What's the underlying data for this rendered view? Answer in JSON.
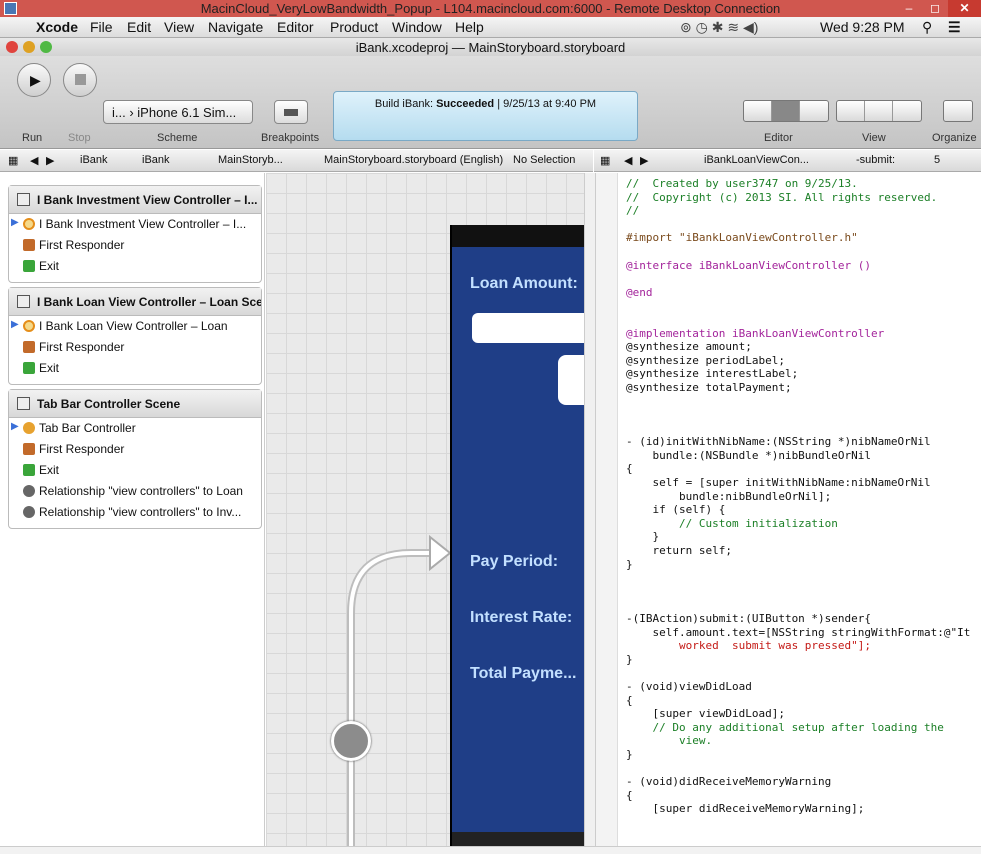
{
  "rdp": {
    "title": "MacinCloud_VeryLowBandwidth_Popup - L104.macincloud.com:6000 - Remote Desktop Connection",
    "min": "–",
    "max": "◻",
    "close": "✕"
  },
  "menubar": {
    "apple": "",
    "items": [
      "Xcode",
      "File",
      "Edit",
      "View",
      "Navigate",
      "Editor",
      "Product",
      "Window",
      "Help"
    ],
    "clock": "Wed 9:28 PM"
  },
  "window": {
    "title": "iBank.xcodeproj — MainStoryboard.storyboard"
  },
  "toolbar": {
    "run_label": "Run",
    "stop_label": "Stop",
    "scheme_label": "Scheme",
    "breakpoints_label": "Breakpoints",
    "scheme_value": "i...  ›  iPhone 6.1 Sim...",
    "status_prefix": "Build iBank: ",
    "status_result": "Succeeded",
    "status_time": "9/25/13 at 9:40 PM",
    "editor_label": "Editor",
    "view_label": "View",
    "organizer_label": "Organize"
  },
  "jumpbar_left": {
    "crumbs": [
      "iBank",
      "iBank",
      "MainStoryb...",
      "MainStoryboard.storyboard (English)",
      "No Selection"
    ]
  },
  "jumpbar_right": {
    "crumbs": [
      "iBankLoanViewCon...",
      "-submit:"
    ],
    "count": "5"
  },
  "outline": {
    "scenes": [
      {
        "title": "I Bank Investment View Controller – I...",
        "rows": [
          {
            "icon": "view-controller-icon",
            "label": "I Bank Investment View Controller – I..."
          },
          {
            "icon": "first-responder-icon",
            "label": "First Responder"
          },
          {
            "icon": "exit-icon",
            "label": "Exit"
          }
        ]
      },
      {
        "title": "I Bank Loan View Controller – Loan Scene",
        "rows": [
          {
            "icon": "view-controller-icon",
            "label": "I Bank Loan View Controller – Loan"
          },
          {
            "icon": "first-responder-icon",
            "label": "First Responder"
          },
          {
            "icon": "exit-icon",
            "label": "Exit"
          }
        ]
      },
      {
        "title": "Tab Bar Controller Scene",
        "rows": [
          {
            "icon": "tab-bar-controller-icon",
            "label": "Tab Bar Controller"
          },
          {
            "icon": "first-responder-icon",
            "label": "First Responder"
          },
          {
            "icon": "exit-icon",
            "label": "Exit"
          },
          {
            "icon": "relationship-icon",
            "label": "Relationship \"view controllers\" to Loan"
          },
          {
            "icon": "relationship-icon",
            "label": "Relationship \"view controllers\" to Inv..."
          }
        ]
      }
    ]
  },
  "canvas": {
    "labels": [
      "Loan Amount:",
      "Pay Period:",
      "Interest Rate:",
      "Total Payme..."
    ]
  },
  "code_lines": [
    [
      "c-com",
      "//  Created by user3747 on 9/25/13."
    ],
    [
      "c-com",
      "//  Copyright (c) 2013 SI. All rights reserved."
    ],
    [
      "c-com",
      "//"
    ],
    [
      "",
      ""
    ],
    [
      "c-pre",
      "#import \"iBankLoanViewController.h\""
    ],
    [
      "",
      ""
    ],
    [
      "c-kw",
      "@interface iBankLoanViewController ()"
    ],
    [
      "",
      ""
    ],
    [
      "c-kw",
      "@end"
    ],
    [
      "",
      ""
    ],
    [
      "",
      ""
    ],
    [
      "c-kw",
      "@implementation iBankLoanViewController"
    ],
    [
      "",
      "@synthesize amount;"
    ],
    [
      "",
      "@synthesize periodLabel;"
    ],
    [
      "",
      "@synthesize interestLabel;"
    ],
    [
      "",
      "@synthesize totalPayment;"
    ],
    [
      "",
      ""
    ],
    [
      "",
      ""
    ],
    [
      "",
      ""
    ],
    [
      "",
      "- (id)initWithNibName:(NSString *)nibNameOrNil"
    ],
    [
      "",
      "    bundle:(NSBundle *)nibBundleOrNil"
    ],
    [
      "",
      "{"
    ],
    [
      "",
      "    self = [super initWithNibName:nibNameOrNil"
    ],
    [
      "",
      "        bundle:nibBundleOrNil];"
    ],
    [
      "",
      "    if (self) {"
    ],
    [
      "c-com",
      "        // Custom initialization"
    ],
    [
      "",
      "    }"
    ],
    [
      "",
      "    return self;"
    ],
    [
      "",
      "}"
    ],
    [
      "",
      ""
    ],
    [
      "",
      ""
    ],
    [
      "",
      ""
    ],
    [
      "",
      "-(IBAction)submit:(UIButton *)sender{"
    ],
    [
      "",
      "    self.amount.text=[NSString stringWithFormat:@\"It"
    ],
    [
      "c-str",
      "        worked  submit was pressed\"];"
    ],
    [
      "",
      "}"
    ],
    [
      "",
      ""
    ],
    [
      "",
      "- (void)viewDidLoad"
    ],
    [
      "",
      "{"
    ],
    [
      "",
      "    [super viewDidLoad];"
    ],
    [
      "c-com",
      "    // Do any additional setup after loading the"
    ],
    [
      "c-com",
      "        view."
    ],
    [
      "",
      "}"
    ],
    [
      "",
      ""
    ],
    [
      "",
      "- (void)didReceiveMemoryWarning"
    ],
    [
      "",
      "{"
    ],
    [
      "",
      "    [super didReceiveMemoryWarning];"
    ]
  ]
}
